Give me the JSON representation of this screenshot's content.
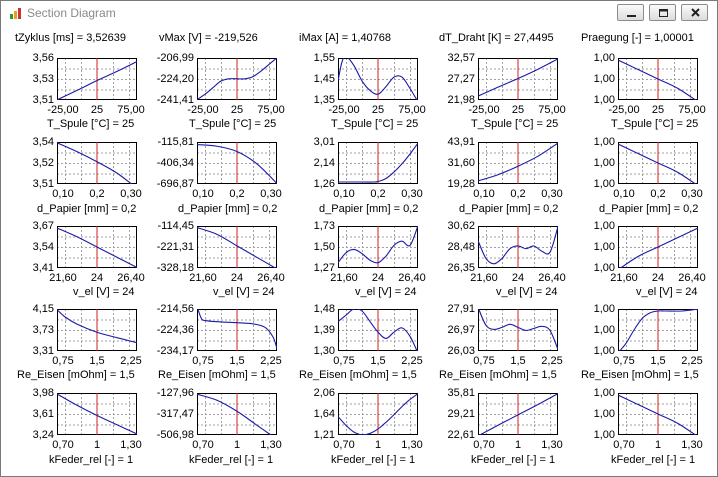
{
  "window": {
    "title": "Section Diagram",
    "icon": "bar-chart-icon",
    "buttons": [
      "minimize-icon",
      "maximize-icon",
      "close-icon"
    ]
  },
  "colors": {
    "curve": "#1a1aaa",
    "marker": "#d02020",
    "grid": "#a0a0a0",
    "frame": "#000000"
  },
  "headers": [
    "tZyklus [ms] = 3,52639",
    "vMax [V] = -219,526",
    "iMax [A] = 1,40768",
    "dT_Draht [K] = 27,4495",
    "Praegung [-] = 1,00001"
  ],
  "rows": [
    {
      "label": "T_Spule [°C] = 25",
      "xticks": [
        "-25,00",
        "25",
        "75,00"
      ],
      "marker": 0.5
    },
    {
      "label": "d_Papier [mm] = 0,2",
      "xticks": [
        "0,10",
        "0,2",
        "0,30"
      ],
      "marker": 0.5
    },
    {
      "label": "v_el [V] = 24",
      "xticks": [
        "21,60",
        "24",
        "26,40"
      ],
      "marker": 0.5
    },
    {
      "label": "Re_Eisen [mOhm] = 1,5",
      "xticks": [
        "0,75",
        "1,5",
        "2,25"
      ],
      "marker": 0.5
    },
    {
      "label": "kFeder_rel [-] = 1",
      "xticks": [
        "0,70",
        "1",
        "1,30"
      ],
      "marker": 0.5
    }
  ],
  "chart_data": [
    {
      "type": "line",
      "col": 0,
      "row": 0,
      "yticks": [
        "3,56",
        "3,53",
        "3,51"
      ],
      "ylim": [
        3.51,
        3.56
      ],
      "x": [
        0,
        0.25,
        0.5,
        0.75,
        1
      ],
      "y": [
        3.5075,
        3.52,
        3.533,
        3.545,
        3.558
      ]
    },
    {
      "type": "line",
      "col": 1,
      "row": 0,
      "yticks": [
        "-206,99",
        "-224,20",
        "-241,41"
      ],
      "ylim": [
        -241.41,
        -206.99
      ],
      "x": [
        0,
        0.1,
        0.2,
        0.3,
        0.4,
        0.5,
        0.6,
        0.7,
        0.8,
        0.9,
        1
      ],
      "y": [
        -243,
        -238,
        -232,
        -226,
        -224,
        -224,
        -224,
        -222,
        -217,
        -211,
        -205
      ]
    },
    {
      "type": "line",
      "col": 2,
      "row": 0,
      "yticks": [
        "1,55",
        "1,45",
        "1,35"
      ],
      "ylim": [
        1.35,
        1.55
      ],
      "x": [
        0,
        0.05,
        0.1,
        0.2,
        0.3,
        0.4,
        0.5,
        0.6,
        0.7,
        0.8,
        0.9,
        1
      ],
      "y": [
        1.44,
        1.54,
        1.57,
        1.52,
        1.44,
        1.39,
        1.37,
        1.41,
        1.46,
        1.46,
        1.4,
        1.33
      ]
    },
    {
      "type": "line",
      "col": 3,
      "row": 0,
      "yticks": [
        "32,57",
        "27,27",
        "21,98"
      ],
      "ylim": [
        21.98,
        32.57
      ],
      "x": [
        0,
        0.25,
        0.5,
        0.75,
        1
      ],
      "y": [
        22.5,
        25.0,
        27.4,
        30.0,
        32.9
      ]
    },
    {
      "type": "line",
      "col": 4,
      "row": 0,
      "yticks": [
        "1,00",
        "1,00",
        "1,00"
      ],
      "ylim": [
        1.0,
        1.00002
      ],
      "x": [
        0,
        0.25,
        0.5,
        0.75,
        1
      ],
      "y": [
        1.00002,
        1.000015,
        1.00001,
        1.000005,
        0.999998
      ]
    },
    {
      "type": "line",
      "col": 0,
      "row": 1,
      "yticks": [
        "3,54",
        "3,52",
        "3,51"
      ],
      "ylim": [
        3.51,
        3.54
      ],
      "x": [
        0,
        0.25,
        0.5,
        0.75,
        1
      ],
      "y": [
        3.541,
        3.534,
        3.526,
        3.517,
        3.505
      ]
    },
    {
      "type": "line",
      "col": 1,
      "row": 1,
      "yticks": [
        "-115,81",
        "-406,34",
        "-696,87"
      ],
      "ylim": [
        -696.87,
        -115.81
      ],
      "x": [
        0,
        0.25,
        0.5,
        0.75,
        1
      ],
      "y": [
        -125,
        -150,
        -230,
        -420,
        -720
      ]
    },
    {
      "type": "line",
      "col": 2,
      "row": 1,
      "yticks": [
        "3,01",
        "2,14",
        "1,26"
      ],
      "ylim": [
        1.26,
        3.01
      ],
      "x": [
        0,
        0.3,
        0.45,
        0.5,
        0.6,
        0.7,
        0.8,
        0.9,
        1
      ],
      "y": [
        1.26,
        1.26,
        1.26,
        1.28,
        1.42,
        1.72,
        2.1,
        2.55,
        3.05
      ]
    },
    {
      "type": "line",
      "col": 3,
      "row": 1,
      "yticks": [
        "43,91",
        "31,60",
        "19,28"
      ],
      "ylim": [
        19.28,
        43.91
      ],
      "x": [
        0,
        0.25,
        0.5,
        0.75,
        1
      ],
      "y": [
        20.0,
        24.0,
        29.5,
        36.0,
        44.5
      ]
    },
    {
      "type": "line",
      "col": 4,
      "row": 1,
      "yticks": [
        "1,00",
        "1,00",
        "1,00"
      ],
      "ylim": [
        1.0,
        1.00002
      ],
      "x": [
        0,
        0.25,
        0.5,
        0.75,
        1
      ],
      "y": [
        1.00002,
        1.000015,
        1.00001,
        1.000005,
        0.999998
      ]
    },
    {
      "type": "line",
      "col": 0,
      "row": 2,
      "yticks": [
        "3,67",
        "3,54",
        "3,41"
      ],
      "ylim": [
        3.41,
        3.67
      ],
      "x": [
        0,
        0.25,
        0.5,
        0.75,
        1
      ],
      "y": [
        3.67,
        3.61,
        3.54,
        3.47,
        3.4
      ]
    },
    {
      "type": "line",
      "col": 1,
      "row": 2,
      "yticks": [
        "-114,45",
        "-221,31",
        "-328,18"
      ],
      "ylim": [
        -328.18,
        -114.45
      ],
      "x": [
        0,
        0.25,
        0.5,
        0.75,
        1
      ],
      "y": [
        -112,
        -150,
        -215,
        -280,
        -345
      ]
    },
    {
      "type": "line",
      "col": 2,
      "row": 2,
      "yticks": [
        "1,73",
        "1,50",
        "1,27"
      ],
      "ylim": [
        1.27,
        1.73
      ],
      "x": [
        0,
        0.1,
        0.2,
        0.3,
        0.4,
        0.5,
        0.6,
        0.7,
        0.8,
        0.9,
        1
      ],
      "y": [
        1.31,
        1.43,
        1.47,
        1.42,
        1.34,
        1.31,
        1.39,
        1.52,
        1.57,
        1.52,
        1.76
      ]
    },
    {
      "type": "line",
      "col": 3,
      "row": 2,
      "yticks": [
        "30,62",
        "28,48",
        "26,35"
      ],
      "ylim": [
        26.35,
        30.62
      ],
      "x": [
        0,
        0.1,
        0.2,
        0.3,
        0.4,
        0.5,
        0.6,
        0.7,
        0.8,
        0.9,
        1
      ],
      "y": [
        29.2,
        27.2,
        26.6,
        27.2,
        28.3,
        28.6,
        28.3,
        28.6,
        28.0,
        27.9,
        30.8
      ]
    },
    {
      "type": "line",
      "col": 4,
      "row": 2,
      "yticks": [
        "1,00",
        "1,00",
        "1,00"
      ],
      "ylim": [
        1.0,
        1.00002
      ],
      "x": [
        0,
        0.25,
        0.5,
        0.75,
        1
      ],
      "y": [
        0.999998,
        1.000005,
        1.00001,
        1.000015,
        1.00002
      ]
    },
    {
      "type": "line",
      "col": 0,
      "row": 3,
      "yticks": [
        "4,15",
        "3,73",
        "3,31"
      ],
      "ylim": [
        3.31,
        4.15
      ],
      "x": [
        0,
        0.1,
        0.25,
        0.5,
        0.75,
        1
      ],
      "y": [
        4.18,
        4.02,
        3.86,
        3.68,
        3.56,
        3.45
      ]
    },
    {
      "type": "line",
      "col": 1,
      "row": 3,
      "yticks": [
        "-214,56",
        "-224,36",
        "-234,17"
      ],
      "ylim": [
        -234.17,
        -214.56
      ],
      "x": [
        0,
        0.05,
        0.1,
        0.3,
        0.5,
        0.7,
        0.85,
        0.95,
        1
      ],
      "y": [
        -212,
        -218,
        -219.5,
        -220.2,
        -220.6,
        -221.2,
        -223,
        -228,
        -234
      ]
    },
    {
      "type": "line",
      "col": 2,
      "row": 3,
      "yticks": [
        "1,48",
        "1,39",
        "1,30"
      ],
      "ylim": [
        1.3,
        1.48
      ],
      "x": [
        0,
        0.1,
        0.2,
        0.3,
        0.4,
        0.5,
        0.6,
        0.7,
        0.8,
        0.9,
        1
      ],
      "y": [
        1.43,
        1.46,
        1.49,
        1.48,
        1.43,
        1.38,
        1.35,
        1.38,
        1.4,
        1.36,
        1.28
      ]
    },
    {
      "type": "line",
      "col": 3,
      "row": 3,
      "yticks": [
        "27,91",
        "26,97",
        "26,03"
      ],
      "ylim": [
        26.03,
        27.91
      ],
      "x": [
        0,
        0.1,
        0.2,
        0.3,
        0.4,
        0.5,
        0.6,
        0.7,
        0.8,
        0.9,
        1
      ],
      "y": [
        28.1,
        27.2,
        27.0,
        27.1,
        27.25,
        27.1,
        26.95,
        27.05,
        27.15,
        26.95,
        26.0
      ]
    },
    {
      "type": "line",
      "col": 4,
      "row": 3,
      "yticks": [
        "1,00",
        "1,00",
        "1,00"
      ],
      "ylim": [
        1.0,
        1.00002
      ],
      "x": [
        0,
        0.1,
        0.2,
        0.3,
        0.4,
        0.5,
        0.6,
        0.8,
        1
      ],
      "y": [
        0.999998,
        1.000003,
        1.00001,
        1.000016,
        1.000019,
        1.00002,
        1.00002,
        1.00002,
        1.000021
      ]
    },
    {
      "type": "line",
      "col": 0,
      "row": 4,
      "yticks": [
        "3,98",
        "3,61",
        "3,24"
      ],
      "ylim": [
        3.24,
        3.98
      ],
      "x": [
        0,
        0.25,
        0.5,
        0.75,
        1
      ],
      "y": [
        4.0,
        3.78,
        3.58,
        3.4,
        3.22
      ]
    },
    {
      "type": "line",
      "col": 1,
      "row": 4,
      "yticks": [
        "-127,96",
        "-317,47",
        "-506,98"
      ],
      "ylim": [
        -506.98,
        -127.96
      ],
      "x": [
        0,
        0.25,
        0.5,
        0.75,
        1
      ],
      "y": [
        -120,
        -180,
        -290,
        -430,
        -570
      ]
    },
    {
      "type": "line",
      "col": 2,
      "row": 4,
      "yticks": [
        "2,06",
        "1,64",
        "1,21"
      ],
      "ylim": [
        1.21,
        2.06
      ],
      "x": [
        0,
        0.1,
        0.2,
        0.3,
        0.4,
        0.5,
        0.6,
        0.7,
        0.8,
        0.9,
        1
      ],
      "y": [
        1.58,
        1.38,
        1.23,
        1.17,
        1.2,
        1.3,
        1.45,
        1.62,
        1.8,
        1.96,
        2.09
      ]
    },
    {
      "type": "line",
      "col": 3,
      "row": 4,
      "yticks": [
        "35,81",
        "29,21",
        "22,61"
      ],
      "ylim": [
        22.61,
        35.81
      ],
      "x": [
        0,
        0.25,
        0.5,
        0.75,
        1
      ],
      "y": [
        21.6,
        25.3,
        28.9,
        32.5,
        36.3
      ]
    },
    {
      "type": "line",
      "col": 4,
      "row": 4,
      "yticks": [
        "1,00",
        "1,00",
        "1,00"
      ],
      "ylim": [
        1.0,
        1.00002
      ],
      "x": [
        0,
        0.25,
        0.5,
        0.75,
        1
      ],
      "y": [
        1.00002,
        1.000015,
        1.00001,
        1.000005,
        0.999998
      ]
    }
  ]
}
